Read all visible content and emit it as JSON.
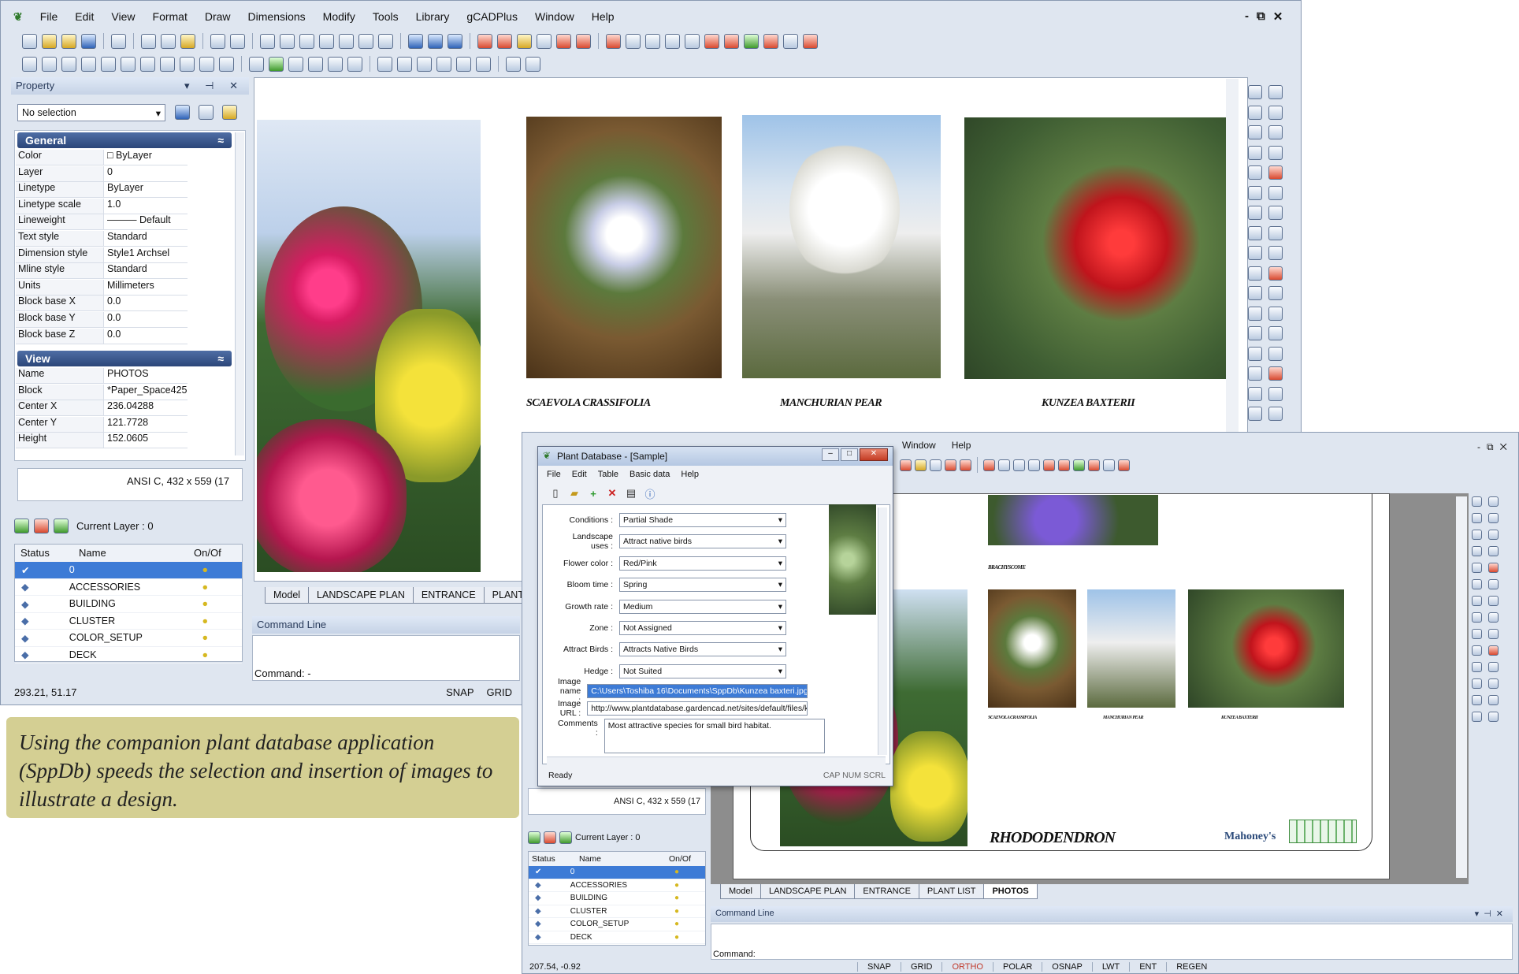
{
  "menu": [
    "File",
    "Edit",
    "View",
    "Format",
    "Draw",
    "Dimensions",
    "Modify",
    "Tools",
    "Library",
    "gCADPlus",
    "Window",
    "Help"
  ],
  "window_controls": {
    "minimize": "-",
    "restore": "⧉",
    "close": "✕"
  },
  "property_panel": {
    "title": "Property",
    "selection": "No selection",
    "general": {
      "header": "General",
      "rows": [
        {
          "k": "Color",
          "v": "□ ByLayer"
        },
        {
          "k": "Layer",
          "v": "0"
        },
        {
          "k": "Linetype",
          "v": "ByLayer"
        },
        {
          "k": "Linetype scale",
          "v": "1.0"
        },
        {
          "k": "Lineweight",
          "v": "——— Default"
        },
        {
          "k": "Text style",
          "v": "Standard"
        },
        {
          "k": "Dimension style",
          "v": "Style1 Archsel"
        },
        {
          "k": "Mline style",
          "v": "Standard"
        },
        {
          "k": "Units",
          "v": "Millimeters"
        },
        {
          "k": "Block base X",
          "v": "0.0"
        },
        {
          "k": "Block base Y",
          "v": "0.0"
        },
        {
          "k": "Block base Z",
          "v": "0.0"
        }
      ]
    },
    "view": {
      "header": "View",
      "rows": [
        {
          "k": "Name",
          "v": "PHOTOS"
        },
        {
          "k": "Block",
          "v": "*Paper_Space425"
        },
        {
          "k": "Center X",
          "v": "236.04288"
        },
        {
          "k": "Center Y",
          "v": "121.7728"
        },
        {
          "k": "Height",
          "v": "152.0605"
        }
      ]
    },
    "paper": "ANSI C,  432 x 559 (17"
  },
  "layers": {
    "current": "Current Layer : 0",
    "headers": [
      "Status",
      "Name",
      "On/Of"
    ],
    "rows": [
      "0",
      "ACCESSORIES",
      "BUILDING",
      "CLUSTER",
      "COLOR_SETUP",
      "DECK"
    ]
  },
  "layout_tabs": [
    "Model",
    "LANDSCAPE PLAN",
    "ENTRANCE",
    "PLANT LIS"
  ],
  "command": {
    "title": "Command Line",
    "prompt": "Command: -"
  },
  "status_coords": "293.21, 51.17",
  "status_buttons": [
    "SNAP",
    "GRID"
  ],
  "canvas_labels": [
    "SCAEVOLA CRASSIFOLIA",
    "MANCHURIAN PEAR",
    "KUNZEA BAXTERII"
  ],
  "note": "Using the companion plant database application (SppDb) speeds the selection and insertion of images to illustrate a design.",
  "db_dialog": {
    "title": "Plant Database - [Sample]",
    "menu": [
      "File",
      "Edit",
      "Table",
      "Basic data",
      "Help"
    ],
    "fields": [
      {
        "k": "Conditions :",
        "v": "Partial Shade"
      },
      {
        "k": "Landscape uses :",
        "v": "Attract native birds"
      },
      {
        "k": "Flower color :",
        "v": "Red/Pink"
      },
      {
        "k": "Bloom time :",
        "v": "Spring"
      },
      {
        "k": "Growth rate :",
        "v": "Medium"
      },
      {
        "k": "Zone :",
        "v": "Not Assigned"
      },
      {
        "k": "Attract Birds :",
        "v": "Attracts Native Birds"
      },
      {
        "k": "Hedge :",
        "v": "Not Suited"
      }
    ],
    "image_name_label": "Image name :",
    "image_name": "C:\\Users\\Toshiba 16\\Documents\\SppDb\\Kunzea baxteri.jpg",
    "image_url_label": "Image URL :",
    "image_url": "http://www.plantdatabase.gardencad.net/sites/default/files/k",
    "comments_label": "Comments :",
    "comments": "Most attractive species for small bird habitat.",
    "status": "Ready",
    "status_right": "CAP  NUM  SCRL"
  },
  "second_window": {
    "menu_partial": [
      "Window",
      "Help"
    ],
    "paper": "ANSI C,  432 x 559 (17",
    "layers_current": "Current Layer : 0",
    "layer_headers": [
      "Status",
      "Name",
      "On/Of"
    ],
    "layer_rows": [
      "0",
      "ACCESSORIES",
      "BUILDING",
      "CLUSTER",
      "COLOR_SETUP",
      "DECK"
    ],
    "small_labels": [
      "BRACHYSCOME",
      "SCAEVOLA CRASSIFOLIA",
      "MANCHURIAN PEAR",
      "KUNZEA BAXTERII"
    ],
    "big_label": "RHODODENDRON",
    "logo_text": "Mahoney's",
    "tabs": [
      "Model",
      "LANDSCAPE PLAN",
      "ENTRANCE",
      "PLANT LIST",
      "PHOTOS"
    ],
    "command_title": "Command Line",
    "command_prompt": "Command:",
    "coords": "207.54, -0.92",
    "status_buttons": [
      "SNAP",
      "GRID",
      "ORTHO",
      "POLAR",
      "OSNAP",
      "LWT",
      "ENT",
      "REGEN"
    ]
  },
  "colors": {
    "ortho_active": "#c0392b",
    "note_bg": "#d4cf93",
    "selection": "#3d7bd6"
  }
}
